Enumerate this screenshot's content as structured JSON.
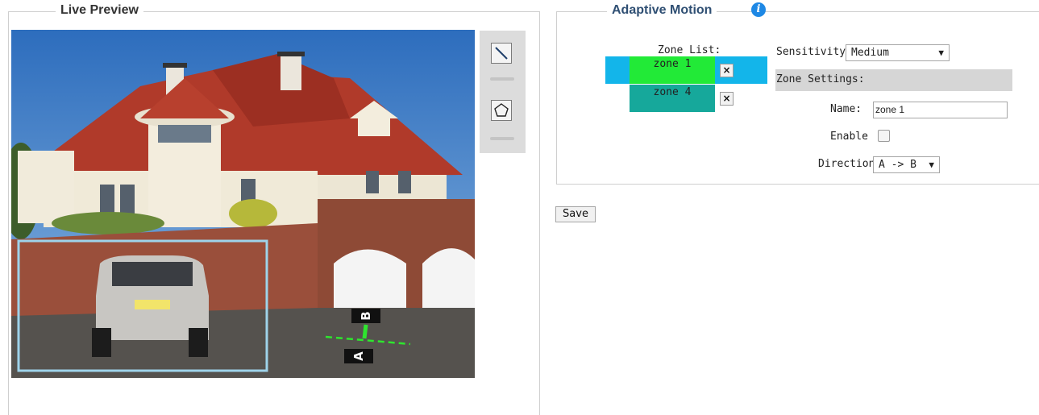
{
  "live_preview": {
    "title": "Live Preview"
  },
  "scene": {
    "marker_a": "A",
    "marker_b": "B"
  },
  "toolbar": {
    "tools": [
      "line-tool",
      "polygon-tool"
    ],
    "active": "line-tool"
  },
  "adaptive_motion": {
    "title": "Adaptive Motion",
    "info_icon": "i",
    "zone_list_label": "Zone List:",
    "zones": [
      {
        "name": "zone 1",
        "color": "#22ea37",
        "selected": true,
        "delete": "×"
      },
      {
        "name": "zone 4",
        "color": "#16a89b",
        "selected": false,
        "delete": "×"
      }
    ],
    "sensitivity_label": "Sensitivity:",
    "sensitivity_value": "Medium",
    "zone_settings_label": "Zone Settings:",
    "name_label": "Name:",
    "name_value": "zone 1",
    "enable_label": "Enable",
    "enable_checked": false,
    "direction_label": "Direction",
    "direction_value": "A -> B",
    "dropdown_arrow": "▼"
  },
  "save_label": "Save",
  "colors": {
    "accent": "#1e88e5",
    "zone_selected_bg": "#13b5ea",
    "title_blue": "#2f4f73"
  }
}
